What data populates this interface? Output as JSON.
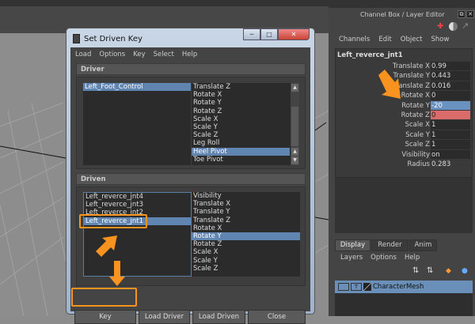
{
  "dialog": {
    "title": "Set Driven Key",
    "menu": [
      "Load",
      "Options",
      "Key",
      "Select",
      "Help"
    ],
    "driver": {
      "header": "Driver",
      "objects": [
        "Left_Foot_Control"
      ],
      "attributes": [
        "Translate Z",
        "Rotate X",
        "Rotate Y",
        "Rotate Z",
        "Scale X",
        "Scale Y",
        "Scale Z",
        "Leg Roll",
        "Heel Pivot",
        "Toe Pivot"
      ],
      "selected_attribute": "Heel Pivot"
    },
    "driven": {
      "header": "Driven",
      "objects": [
        "Left_reverce_jnt4",
        "Left_reverce_jnt3",
        "Left_reverce_jnt2",
        "Left_reverce_jnt1"
      ],
      "selected_object": "Left_reverce_jnt1",
      "attributes": [
        "Visibility",
        "Translate X",
        "Translate Y",
        "Translate Z",
        "Rotate X",
        "Rotate Y",
        "Rotate Z",
        "Scale X",
        "Scale Y",
        "Scale Z"
      ],
      "selected_attribute": "Rotate Y"
    },
    "buttons": {
      "key": "Key",
      "load_driver": "Load Driver",
      "load_driven": "Load Driven",
      "close": "Close"
    }
  },
  "channel_box": {
    "title": "Channel Box / Layer Editor",
    "menu": [
      "Channels",
      "Edit",
      "Object",
      "Show"
    ],
    "object": "Left_reverce_jnt1",
    "channels": [
      {
        "label": "Translate X",
        "value": "0.99"
      },
      {
        "label": "Translate Y",
        "value": "0.443"
      },
      {
        "label": "Translate Z",
        "value": "0.016"
      },
      {
        "label": "Rotate X",
        "value": "0"
      },
      {
        "label": "Rotate Y",
        "value": "-20"
      },
      {
        "label": "Rotate Z",
        "value": "0"
      },
      {
        "label": "Scale X",
        "value": "1"
      },
      {
        "label": "Scale Y",
        "value": "1"
      },
      {
        "label": "Scale Z",
        "value": "1"
      },
      {
        "label": "Visibility",
        "value": "on"
      },
      {
        "label": "Radius",
        "value": "0.283"
      }
    ]
  },
  "layer_editor": {
    "tabs": [
      "Display",
      "Render",
      "Anim"
    ],
    "menu": [
      "Layers",
      "Options",
      "Help"
    ],
    "layer": {
      "t": "T",
      "name": "CharacterMesh"
    }
  },
  "colors": {
    "accent": "#f7931e",
    "selection": "#6085b0",
    "keyed": "#d96b6b"
  }
}
